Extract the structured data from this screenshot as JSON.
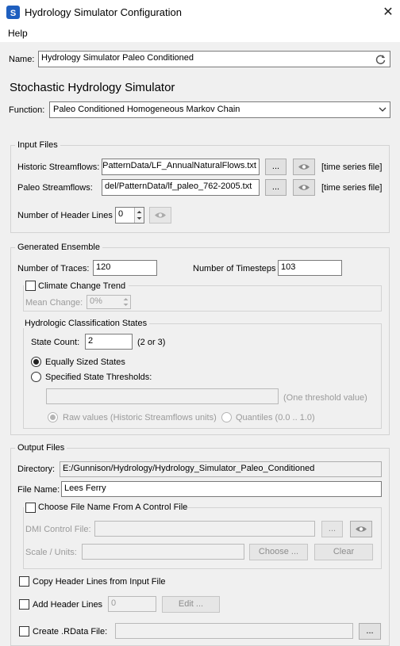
{
  "window": {
    "title": "Hydrology Simulator Configuration",
    "close_glyph": "✕",
    "icon": "app-logo-icon"
  },
  "menu": {
    "help": "Help"
  },
  "name": {
    "label": "Name:",
    "value": "Hydrology Simulator Paleo Conditioned",
    "refresh_icon": "refresh-icon"
  },
  "heading": "Stochastic Hydrology Simulator",
  "function": {
    "label": "Function:",
    "value": "Paleo Conditioned Homogeneous Markov Chain"
  },
  "input_files": {
    "title": "Input Files",
    "historic_label": "Historic Streamflows:",
    "historic_value": "PatternData/LF_AnnualNaturalFlows.txt",
    "paleo_label": "Paleo Streamflows:",
    "paleo_value": "del/PatternData/lf_paleo_762-2005.txt",
    "browse": "...",
    "type_hint": "[time series file]",
    "header_lines_label": "Number of Header Lines",
    "header_lines_value": "0"
  },
  "ensemble": {
    "title": "Generated Ensemble",
    "traces_label": "Number of Traces:",
    "traces_value": "120",
    "timesteps_label": "Number of Timesteps",
    "timesteps_value": "103",
    "climate_label": "Climate Change Trend",
    "mean_change_label": "Mean Change:",
    "mean_change_value": "0%",
    "classification": {
      "title": "Hydrologic Classification States",
      "state_count_label": "State Count:",
      "state_count_value": "2",
      "state_count_hint": "(2 or 3)",
      "equal_label": "Equally Sized States",
      "specified_label": "Specified State Thresholds:",
      "threshold_hint": "(One threshold value)",
      "raw_label": "Raw values (Historic Streamflows units)",
      "quantiles_label": "Quantiles (0.0 .. 1.0)"
    }
  },
  "output": {
    "title": "Output Files",
    "directory_label": "Directory:",
    "directory_value": "E:/Gunnison/Hydrology/Hydrology_Simulator_Paleo_Conditioned",
    "filename_label": "File Name:",
    "filename_value": "Lees Ferry",
    "control_file_label": "Choose File Name From A Control File",
    "dmi_label": "DMI Control File:",
    "dmi_browse": "...",
    "scale_label": "Scale / Units:",
    "choose": "Choose ...",
    "clear": "Clear",
    "copy_header_label": "Copy Header Lines from Input File",
    "add_header_label": "Add Header Lines",
    "add_header_value": "0",
    "edit": "Edit ...",
    "rdata_label": "Create .RData File:",
    "rdata_browse": "..."
  }
}
